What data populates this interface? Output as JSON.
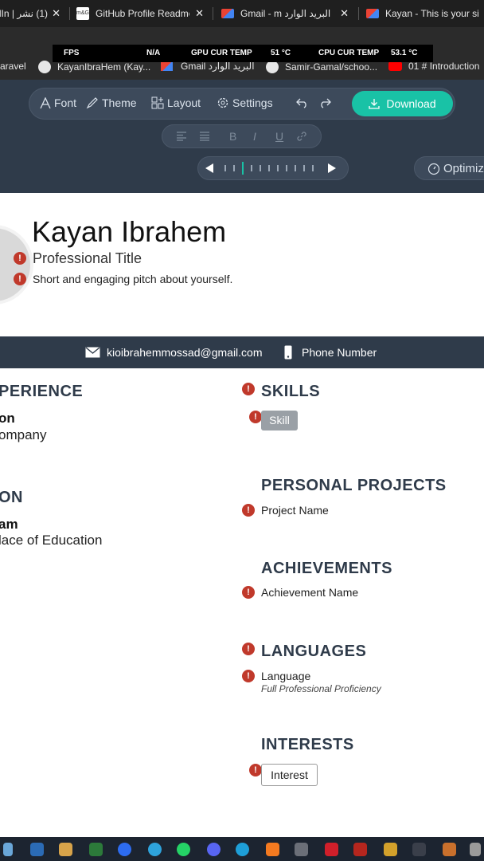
{
  "browser": {
    "tabs": [
      {
        "label": "(1) نشر | lIn",
        "icon": "linkedin-icon"
      },
      {
        "label": "GitHub Profile Readme",
        "icon": "mg-favicon"
      },
      {
        "label": "البريد الوارد Gmail - m",
        "icon": "gmail-icon"
      },
      {
        "label": "Kayan - This is your si",
        "icon": "gmail-icon"
      }
    ],
    "bookmarks": [
      {
        "label": "aravel",
        "icon": "laravel-icon"
      },
      {
        "label": "KayanIbraHem (Kay...",
        "icon": "github-icon"
      },
      {
        "label": "Gmail البريد الوارد",
        "icon": "gmail-icon"
      },
      {
        "label": "Samir-Gamal/schoo...",
        "icon": "github-icon"
      },
      {
        "label": "01 # Introduction",
        "icon": "youtube-icon"
      }
    ]
  },
  "overlay": {
    "fps_label": "FPS",
    "fps_value": "N/A",
    "gpu_label": "GPU CUR TEMP",
    "gpu_value": "51 °C",
    "cpu_label": "CPU CUR TEMP",
    "cpu_value": "53.1 °C"
  },
  "toolbar": {
    "font": "Font",
    "theme": "Theme",
    "layout": "Layout",
    "settings": "Settings",
    "download": "Download",
    "optimize": "Optimiz",
    "format": {
      "bold": "B",
      "italic": "I",
      "underline": "U"
    },
    "slider_ticks": 11,
    "slider_active": 2
  },
  "resume": {
    "name": "Kayan Ibrahem",
    "title": "Professional Title",
    "pitch": "Short and engaging pitch about yourself.",
    "email": "kioibrahemmossad@gmail.com",
    "phone": "Phone Number",
    "left": {
      "experience_heading": "PERIENCE",
      "experience_role": "on",
      "experience_company": "ompany",
      "education_heading": "ON",
      "education_program": "am",
      "education_place": "lace of Education"
    },
    "right": {
      "skills_heading": "SKILLS",
      "skill": "Skill",
      "projects_heading": "PERSONAL PROJECTS",
      "project": "Project Name",
      "achievements_heading": "ACHIEVEMENTS",
      "achievement": "Achievement Name",
      "languages_heading": "LANGUAGES",
      "language": "Language",
      "proficiency": "Full Professional Proficiency",
      "interests_heading": "INTERESTS",
      "interest": "Interest"
    }
  },
  "colors": {
    "accent": "#19c2a6",
    "header_bg": "#2f3b4a",
    "warning": "#c0392b"
  }
}
